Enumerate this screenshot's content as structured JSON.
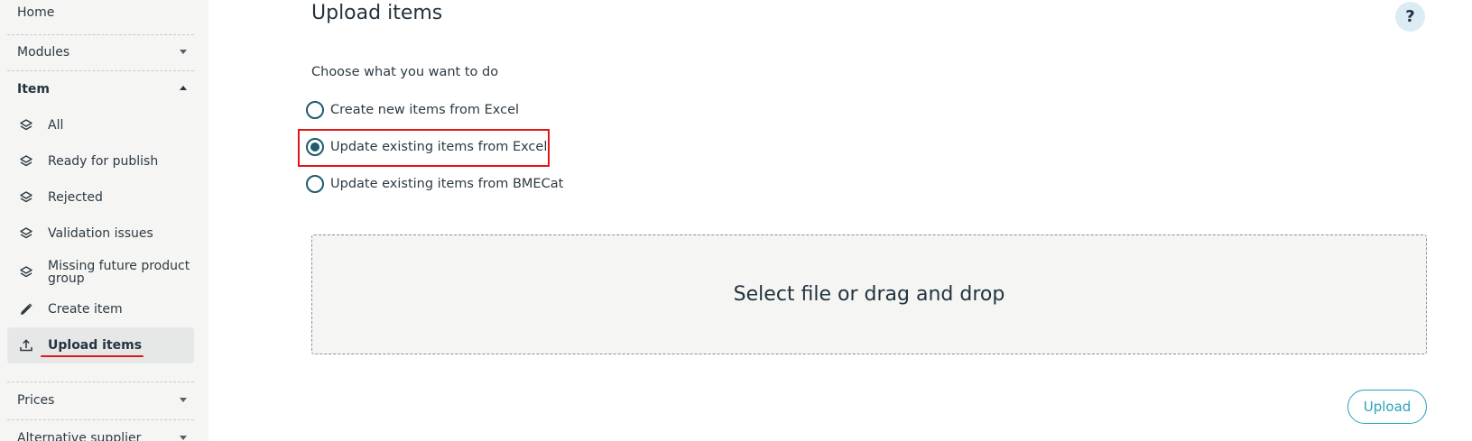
{
  "sidebar": {
    "home_label": "Home",
    "modules_label": "Modules",
    "item_section_label": "Item",
    "items": [
      {
        "label": "All",
        "icon": "layers-icon"
      },
      {
        "label": "Ready for publish",
        "icon": "layers-icon"
      },
      {
        "label": "Rejected",
        "icon": "layers-icon"
      },
      {
        "label": "Validation issues",
        "icon": "layers-icon"
      },
      {
        "label": "Missing future product group",
        "icon": "layers-icon"
      },
      {
        "label": "Create item",
        "icon": "pencil-icon"
      },
      {
        "label": "Upload items",
        "icon": "upload-icon",
        "active": true
      }
    ],
    "prices_label": "Prices",
    "alt_supplier_label": "Alternative supplier"
  },
  "main": {
    "title": "Upload items",
    "help_label": "?",
    "prompt": "Choose what you want to do",
    "options": [
      {
        "label": "Create new items from Excel",
        "selected": false
      },
      {
        "label": "Update existing items from Excel",
        "selected": true
      },
      {
        "label": "Update existing items from BMECat",
        "selected": false
      }
    ],
    "dropzone_label": "Select file or drag and drop",
    "upload_label": "Upload"
  },
  "colors": {
    "accent": "#28a3b8",
    "radio": "#1f5a6e",
    "annotation_red": "#e01616"
  }
}
